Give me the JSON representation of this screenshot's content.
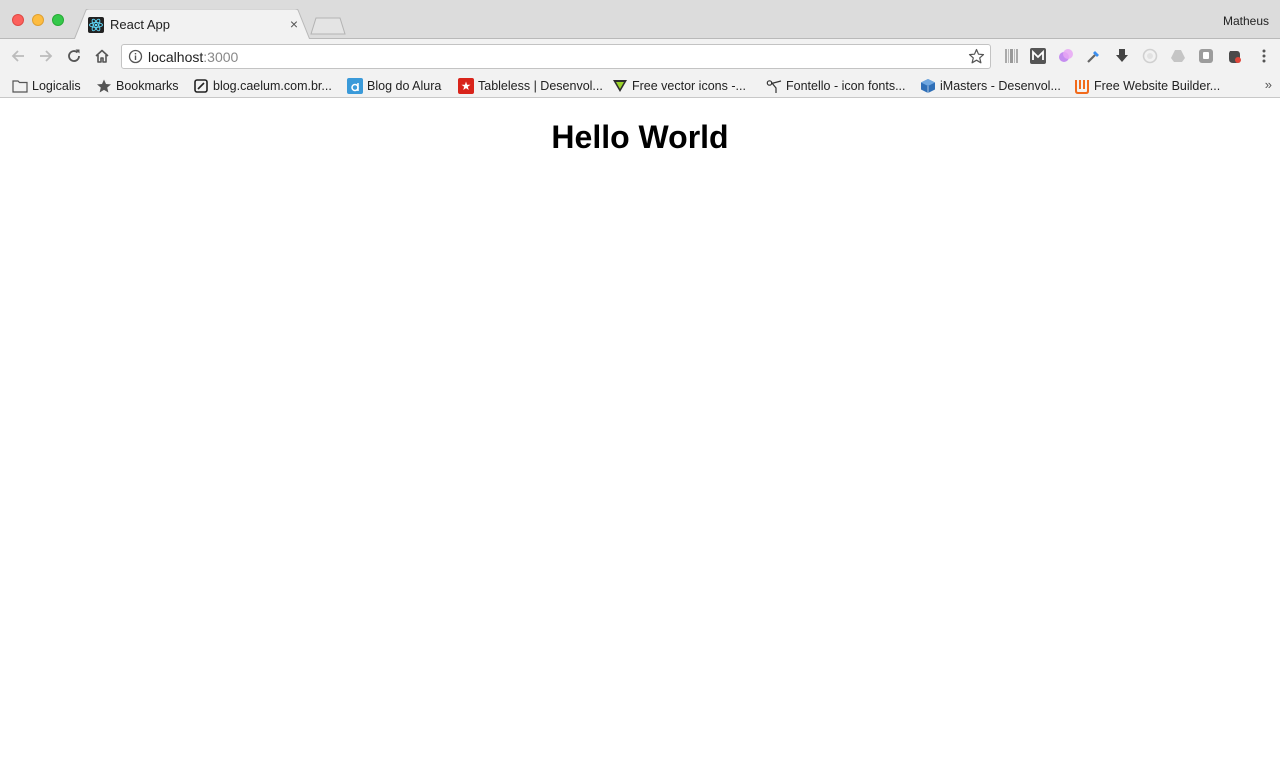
{
  "tab": {
    "title": "React App",
    "close_glyph": "×"
  },
  "profile": {
    "name": "Matheus"
  },
  "omnibox": {
    "host": "localhost",
    "port": ":3000"
  },
  "bookmarks": [
    {
      "label": "Logicalis",
      "icon": "folder-icon"
    },
    {
      "label": "Bookmarks",
      "icon": "star-icon"
    },
    {
      "label": "blog.caelum.com.br...",
      "icon": "caelum-icon"
    },
    {
      "label": "Blog do Alura",
      "icon": "alura-icon"
    },
    {
      "label": "Tableless | Desenvol...",
      "icon": "tableless-icon"
    },
    {
      "label": "Free vector icons -...",
      "icon": "freepik-icon"
    },
    {
      "label": "Fontello - icon fonts...",
      "icon": "scissors-icon"
    },
    {
      "label": "iMasters - Desenvol...",
      "icon": "imasters-icon"
    },
    {
      "label": "Free Website Builder...",
      "icon": "wix-icon"
    }
  ],
  "bookmarks_more": "»",
  "page": {
    "heading": "Hello World"
  },
  "colors": {
    "react": "#61dafb",
    "accent_close": "#fc605c",
    "accent_min": "#fdbc40",
    "accent_max": "#34c84a"
  }
}
